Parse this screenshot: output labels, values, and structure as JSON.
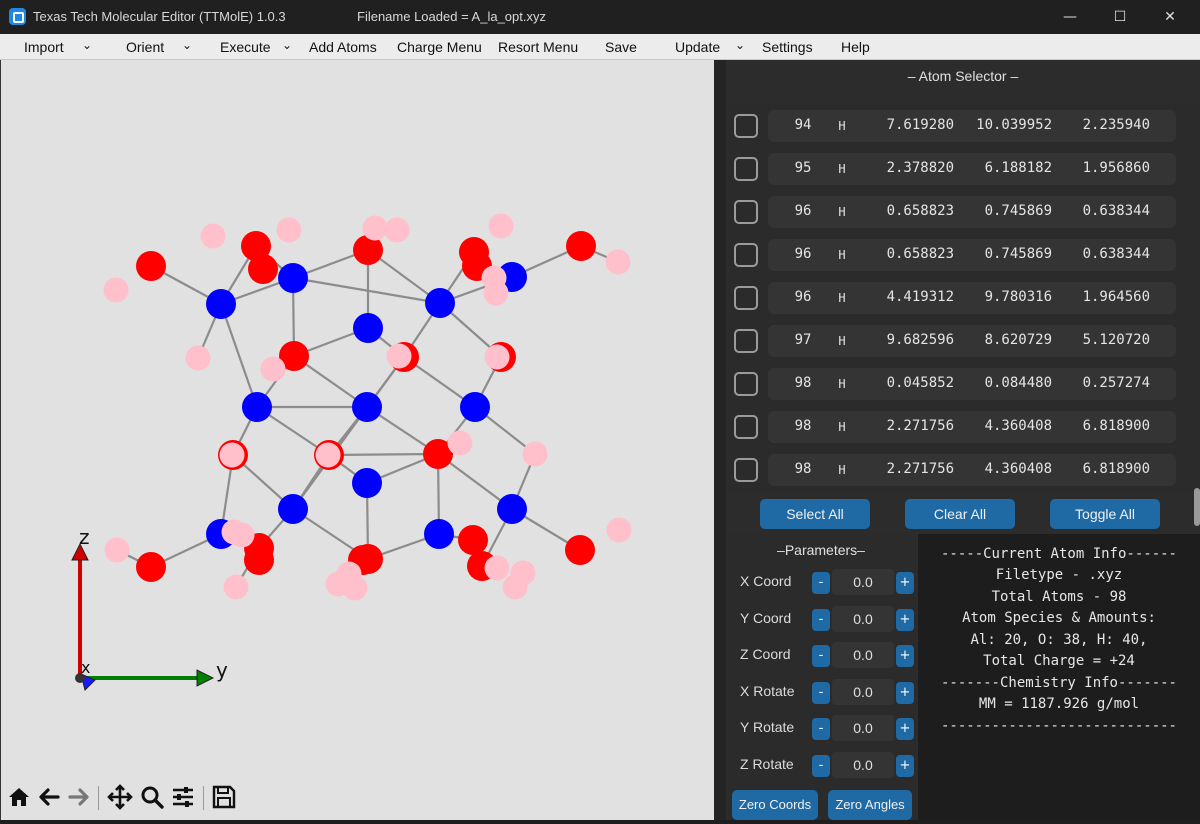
{
  "window": {
    "title": "Texas Tech Molecular Editor (TTMolE) 1.0.3",
    "filename_loaded": "Filename Loaded = A_la_opt.xyz",
    "minimize": "—",
    "maximize": "☐",
    "close": "✕"
  },
  "menu": {
    "import": "Import",
    "orient": "Orient",
    "execute": "Execute",
    "add_atoms": "Add Atoms",
    "charge_menu": "Charge Menu",
    "resort_menu": "Resort Menu",
    "save": "Save",
    "update": "Update",
    "settings": "Settings",
    "help": "Help",
    "chevron": "⌄"
  },
  "axes": {
    "z": "z",
    "y": "y",
    "x": "x"
  },
  "colors": {
    "aluminum": "#0000ff",
    "oxygen": "#ff0000",
    "hydrogen": "#ffc0cb",
    "bond": "#8c8c8c"
  },
  "toolbar_icons": [
    "home-icon",
    "back-arrow-icon",
    "forward-arrow-icon",
    "pan-icon",
    "zoom-icon",
    "configure-icon",
    "save-figure-icon"
  ],
  "atom_selector": {
    "title": "– Atom Selector –",
    "rows": [
      {
        "index": "94",
        "element": "H",
        "x": "7.619280",
        "y": "10.039952",
        "z": "2.235940"
      },
      {
        "index": "95",
        "element": "H",
        "x": "2.378820",
        "y": "6.188182",
        "z": "1.956860"
      },
      {
        "index": "96",
        "element": "H",
        "x": "0.658823",
        "y": "0.745869",
        "z": "0.638344"
      },
      {
        "index": "96",
        "element": "H",
        "x": "0.658823",
        "y": "0.745869",
        "z": "0.638344"
      },
      {
        "index": "96",
        "element": "H",
        "x": "4.419312",
        "y": "9.780316",
        "z": "1.964560"
      },
      {
        "index": "97",
        "element": "H",
        "x": "9.682596",
        "y": "8.620729",
        "z": "5.120720"
      },
      {
        "index": "98",
        "element": "H",
        "x": "0.045852",
        "y": "0.084480",
        "z": "0.257274"
      },
      {
        "index": "98",
        "element": "H",
        "x": "2.271756",
        "y": "4.360408",
        "z": "6.818900"
      },
      {
        "index": "98",
        "element": "H",
        "x": "2.271756",
        "y": "4.360408",
        "z": "6.818900"
      }
    ],
    "select_all": "Select All",
    "clear_all": "Clear All",
    "toggle_all": "Toggle All"
  },
  "parameters": {
    "title": "–Parameters–",
    "minus": "-",
    "plus": "+",
    "rows": [
      {
        "label": "X Coord",
        "value": "0.0"
      },
      {
        "label": "Y Coord",
        "value": "0.0"
      },
      {
        "label": "Z Coord",
        "value": "0.0"
      },
      {
        "label": "X Rotate",
        "value": "0.0"
      },
      {
        "label": "Y Rotate",
        "value": "0.0"
      },
      {
        "label": "Z Rotate",
        "value": "0.0"
      }
    ],
    "zero_coords": "Zero Coords",
    "zero_angles": "Zero Angles"
  },
  "atom_info": {
    "lines": [
      "-----Current Atom Info------",
      "Filetype - .xyz",
      "Total Atoms - 98",
      "Atom Species & Amounts:",
      "Al: 20, O: 38, H: 40,",
      "Total Charge = +24",
      "-------Chemistry Info-------",
      "MM = 1187.926 g/mol",
      "----------------------------"
    ]
  }
}
